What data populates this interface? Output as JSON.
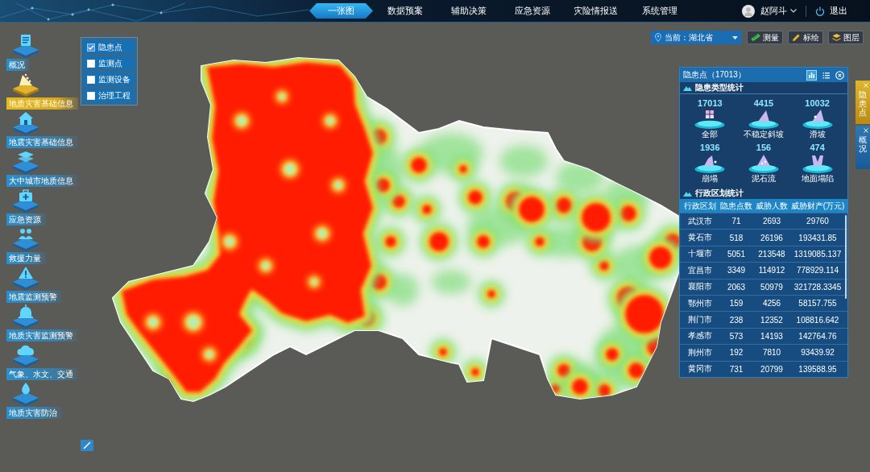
{
  "top_bar": {
    "tabs": [
      {
        "label": "一张图",
        "selected": true
      },
      {
        "label": "数据预案",
        "selected": false
      },
      {
        "label": "辅助决策",
        "selected": false
      },
      {
        "label": "应急资源",
        "selected": false
      },
      {
        "label": "灾险情报送",
        "selected": false
      },
      {
        "label": "系统管理",
        "selected": false
      }
    ],
    "user": "赵阿斗",
    "logout": "退出"
  },
  "sidebar": {
    "items": [
      {
        "label": "概况",
        "selected": false
      },
      {
        "label": "地质灾害基础信息",
        "selected": true
      },
      {
        "label": "地震灾害基础信息",
        "selected": false
      },
      {
        "label": "大中城市地质信息",
        "selected": false
      },
      {
        "label": "应急资源",
        "selected": false
      },
      {
        "label": "救援力量",
        "selected": false
      },
      {
        "label": "地震监测预警",
        "selected": false
      },
      {
        "label": "地质灾害监测预警",
        "selected": false
      },
      {
        "label": "气象、水文、交通",
        "selected": false
      },
      {
        "label": "地质灾害防治",
        "selected": false
      }
    ]
  },
  "layer_popup": {
    "options": [
      {
        "label": "隐患点",
        "checked": true
      },
      {
        "label": "监测点",
        "checked": false
      },
      {
        "label": "监测设备",
        "checked": false
      },
      {
        "label": "治理工程",
        "checked": false
      }
    ]
  },
  "map_toolbar": {
    "region_select": "当前：湖北省",
    "buttons": [
      "测量",
      "标绘",
      "图层"
    ]
  },
  "panel": {
    "title": "隐患点（17013）",
    "views": [
      {
        "selected": true
      },
      {
        "selected": false
      }
    ],
    "type_stats": {
      "title": "隐患类型统计",
      "items": [
        {
          "count": "17013",
          "name": "全部"
        },
        {
          "count": "4415",
          "name": "不稳定斜坡"
        },
        {
          "count": "10032",
          "name": "滑坡"
        },
        {
          "count": "1936",
          "name": "崩塌"
        },
        {
          "count": "156",
          "name": "泥石流"
        },
        {
          "count": "474",
          "name": "地面塌陷"
        }
      ]
    },
    "region_stats": {
      "title": "行政区划统计",
      "columns": [
        "行政区划",
        "隐患点数",
        "威胁人数",
        "威胁财产(万元)"
      ],
      "rows": [
        [
          "武汉市",
          "71",
          "2693",
          "29760"
        ],
        [
          "黄石市",
          "518",
          "26196",
          "193431.85"
        ],
        [
          "十堰市",
          "5051",
          "213548",
          "1319085.137"
        ],
        [
          "宜昌市",
          "3349",
          "114912",
          "778929.114"
        ],
        [
          "襄阳市",
          "2063",
          "50979",
          "321728.3345"
        ],
        [
          "鄂州市",
          "159",
          "4256",
          "58157.755"
        ],
        [
          "荆门市",
          "238",
          "12352",
          "108816.642"
        ],
        [
          "孝感市",
          "573",
          "14193",
          "142764.76"
        ],
        [
          "荆州市",
          "192",
          "7810",
          "93439.92"
        ],
        [
          "黄冈市",
          "731",
          "20799",
          "139588.95"
        ]
      ]
    }
  },
  "side_tabs": [
    {
      "label": "隐患点",
      "selected": true
    },
    {
      "label": "概况",
      "selected": false
    }
  ]
}
